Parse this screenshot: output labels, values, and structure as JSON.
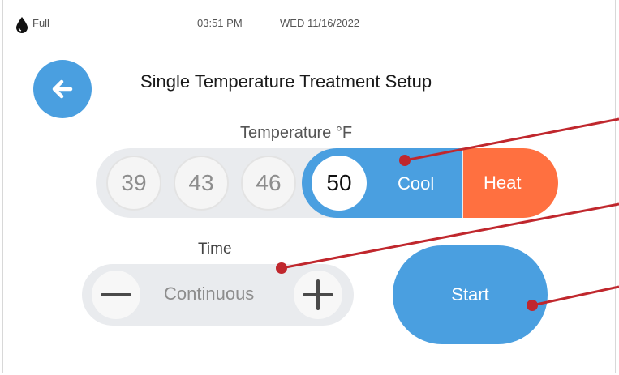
{
  "status_bar": {
    "fill_icon": "water-drop-icon",
    "fill_label": "Full",
    "time": "03:51 PM",
    "date": "WED 11/16/2022"
  },
  "header": {
    "back_icon": "arrow-left-icon",
    "title": "Single Temperature Treatment Setup"
  },
  "temperature": {
    "label": "Temperature °F",
    "options": [
      "39",
      "43",
      "46",
      "50"
    ],
    "selected": "50",
    "modes": [
      "Cool",
      "Heat"
    ],
    "selected_mode": "Cool"
  },
  "time": {
    "label": "Time",
    "value": "Continuous",
    "decrement_icon": "minus-icon",
    "increment_icon": "plus-icon"
  },
  "start": {
    "label": "Start"
  },
  "colors": {
    "primary": "#4a9fe0",
    "heat": "#ff7040",
    "track": "#e9ebee",
    "callout": "#c0272d"
  }
}
